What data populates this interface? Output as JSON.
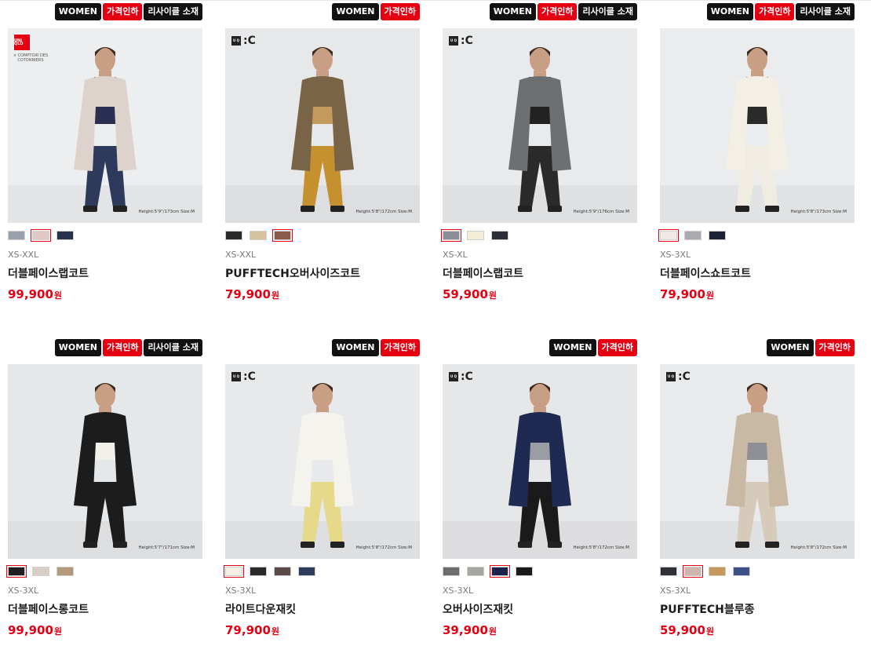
{
  "products": [
    {
      "badges": [
        {
          "label": "WOMEN",
          "style": "black"
        },
        {
          "label": "가격인하",
          "style": "red"
        },
        {
          "label": "리사이클 소재",
          "style": "black"
        }
      ],
      "logo": "uniqlo-x-comptoir",
      "logo_text": "UNI QLO",
      "collab_text": "× COMPTOIR DES COTONNIERS",
      "height_note": "Height:5'9\"/173cm Size:M",
      "bg": "#eceeef",
      "coat": "#ddd3cc",
      "inner": "#2b2f52",
      "pants": "#2d3a5c",
      "colors": [
        "#9aa1ad",
        "#e0c8c4",
        "#27304f"
      ],
      "selected": 1,
      "sizes": "XS-XXL",
      "name": "더블페이스랩코트",
      "price": "99,900",
      "currency": "원"
    },
    {
      "badges": [
        {
          "label": "WOMEN",
          "style": "black"
        },
        {
          "label": "가격인하",
          "style": "red"
        }
      ],
      "logo": "uniqlo-c",
      "logo_text": "U Q",
      "logo_c": ":C",
      "height_note": "Height:5'8\"/172cm Size:M",
      "bg": "#e6e8ea",
      "coat": "#7a6448",
      "inner": "#c49a5c",
      "pants": "#c5902e",
      "colors": [
        "#2a2a2a",
        "#d7c3a2",
        "#8a5a4c"
      ],
      "selected": 2,
      "sizes": "XS-XXL",
      "name": "PUFFTECH오버사이즈코트",
      "price": "79,900",
      "currency": "원"
    },
    {
      "badges": [
        {
          "label": "WOMEN",
          "style": "black"
        },
        {
          "label": "가격인하",
          "style": "red"
        },
        {
          "label": "리사이클 소재",
          "style": "black"
        }
      ],
      "logo": "uniqlo-c",
      "logo_text": "U Q",
      "logo_c": ":C",
      "height_note": "Height:5'9\"/176cm Size:M",
      "bg": "#e8eaec",
      "coat": "#6e6f72",
      "inner": "#222",
      "pants": "#2a2a2a",
      "colors": [
        "#8a8e96",
        "#f4ecd6",
        "#2b2e36"
      ],
      "selected": 0,
      "sizes": "XS-XL",
      "name": "더블페이스랩코트",
      "price": "59,900",
      "currency": "원"
    },
    {
      "badges": [
        {
          "label": "WOMEN",
          "style": "black"
        },
        {
          "label": "가격인하",
          "style": "red"
        },
        {
          "label": "리사이클 소재",
          "style": "black"
        }
      ],
      "logo": "none",
      "height_note": "Height:5'8\"/173cm Size:M",
      "bg": "#eaeced",
      "coat": "#f3efe4",
      "inner": "#2a2a2a",
      "pants": "#f0ece2",
      "colors": [
        "#f2e8e4",
        "#a9abb0",
        "#1c2236"
      ],
      "selected": 0,
      "sizes": "XS-3XL",
      "name": "더블페이스쇼트코트",
      "price": "79,900",
      "currency": "원"
    },
    {
      "badges": [
        {
          "label": "WOMEN",
          "style": "black"
        },
        {
          "label": "가격인하",
          "style": "red"
        },
        {
          "label": "리사이클 소재",
          "style": "black"
        }
      ],
      "logo": "none",
      "height_note": "Height:5'7\"/171cm Size:M",
      "bg": "#e5e8ea",
      "coat": "#1c1c1c",
      "inner": "#f2f0ea",
      "pants": "#1c1c1c",
      "colors": [
        "#1f1f1f",
        "#d9cdc6",
        "#b39a7c"
      ],
      "selected": 0,
      "sizes": "XS-3XL",
      "name": "더블페이스롱코트",
      "price": "99,900",
      "currency": "원"
    },
    {
      "badges": [
        {
          "label": "WOMEN",
          "style": "black"
        },
        {
          "label": "가격인하",
          "style": "red"
        }
      ],
      "logo": "uniqlo-c",
      "logo_text": "U Q",
      "logo_c": ":C",
      "height_note": "Height:5'8\"/172cm Size:M",
      "bg": "#e7e9eb",
      "coat": "#f5f3ee",
      "inner": "#f5f3ee",
      "pants": "#e6d98a",
      "colors": [
        "#f6efe6",
        "#2a2a2a",
        "#5a4a48",
        "#303a5c"
      ],
      "selected": 0,
      "sizes": "XS-3XL",
      "name": "라이트다운재킷",
      "price": "79,900",
      "currency": "원"
    },
    {
      "badges": [
        {
          "label": "WOMEN",
          "style": "black"
        },
        {
          "label": "가격인하",
          "style": "red"
        }
      ],
      "logo": "uniqlo-c",
      "logo_text": "U Q",
      "logo_c": ":C",
      "height_note": "Height:5'8\"/172cm Size:M",
      "bg": "#e6e7e9",
      "coat": "#1f2a52",
      "inner": "#9a9ea4",
      "pants": "#1a1a1a",
      "colors": [
        "#6a6c70",
        "#a8a6a0",
        "#1c2348",
        "#1a1a1a"
      ],
      "selected": 2,
      "sizes": "XS-3XL",
      "name": "오버사이즈재킷",
      "price": "39,900",
      "currency": "원"
    },
    {
      "badges": [
        {
          "label": "WOMEN",
          "style": "black"
        },
        {
          "label": "가격인하",
          "style": "red"
        }
      ],
      "logo": "uniqlo-c",
      "logo_text": "U Q",
      "logo_c": ":C",
      "height_note": "Height:5'8\"/172cm Size:M",
      "bg": "#e9eaeb",
      "coat": "#c9b9a4",
      "inner": "#8e8f94",
      "pants": "#d6cbbb",
      "colors": [
        "#2e3138",
        "#cfb7ae",
        "#c49a5c",
        "#3e5088"
      ],
      "selected": 1,
      "sizes": "XS-3XL",
      "name": "PUFFTECH블루종",
      "price": "59,900",
      "currency": "원"
    }
  ]
}
